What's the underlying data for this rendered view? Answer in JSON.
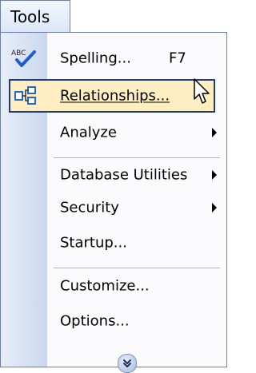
{
  "menu": {
    "title": "Tools"
  },
  "items": [
    {
      "label": "Spelling...",
      "shortcut": "F7"
    },
    {
      "label": "Relationships..."
    },
    {
      "label": "Analyze"
    },
    {
      "label": "Database Utilities"
    },
    {
      "label": "Security"
    },
    {
      "label": "Startup..."
    },
    {
      "label": "Customize..."
    },
    {
      "label": "Options..."
    }
  ],
  "colors": {
    "highlight_fill": "#ffeec2",
    "highlight_border": "#1f3b7a",
    "gutter": "#c9d7ee"
  },
  "icons": [
    "spelling-icon",
    "relationships-icon",
    "expand-chevron-icon",
    "mouse-cursor-icon"
  ]
}
